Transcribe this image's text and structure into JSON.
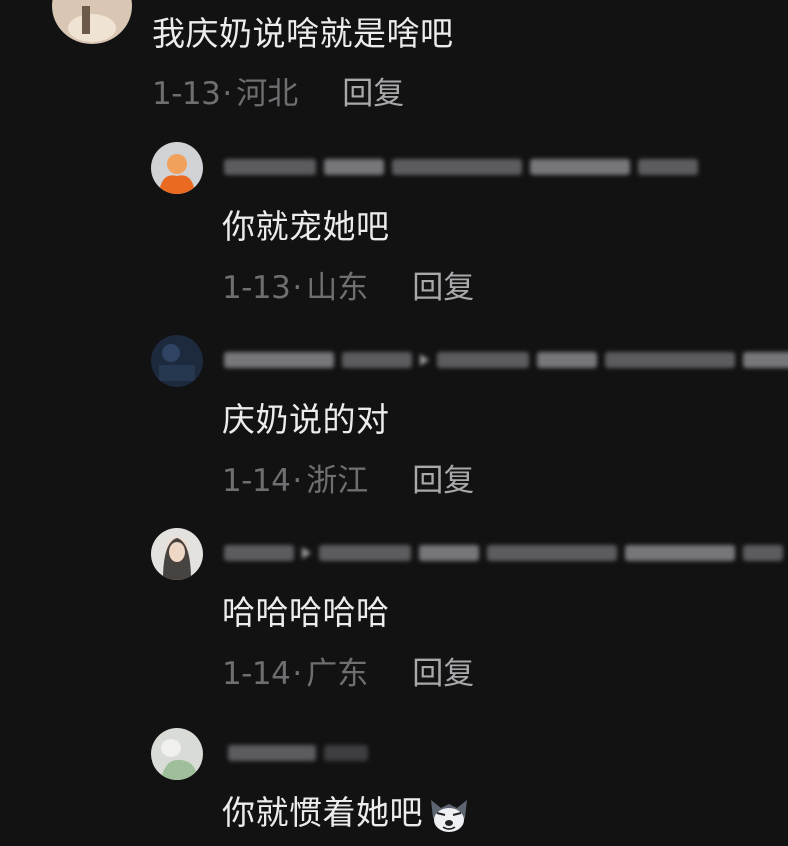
{
  "top_comment": {
    "text": "我庆奶说啥就是啥吧",
    "date": "1-13",
    "location": "河北",
    "reply_label": "回复"
  },
  "replies": [
    {
      "text": "你就宠她吧",
      "date": "1-13",
      "location": "山东",
      "reply_label": "回复"
    },
    {
      "text": "庆奶说的对",
      "date": "1-14",
      "location": "浙江",
      "reply_label": "回复"
    },
    {
      "text": "哈哈哈哈哈",
      "date": "1-14",
      "location": "广东",
      "reply_label": "回复"
    },
    {
      "text": "你就惯着她吧",
      "emoji": "husky-emoji"
    }
  ],
  "meta_separator": "·",
  "colors": {
    "background": "#121213",
    "text": "#ececec",
    "meta": "#6f6f72",
    "reply": "#a9a9ac"
  }
}
